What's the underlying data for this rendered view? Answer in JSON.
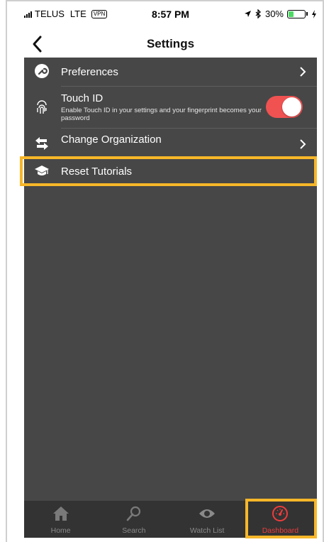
{
  "status_bar": {
    "carrier": "TELUS",
    "network": "LTE",
    "vpn": "VPN",
    "time": "8:57 PM",
    "battery": "30%",
    "battery_level": 0.3
  },
  "nav": {
    "title": "Settings",
    "back_icon": "chevron-left-icon"
  },
  "settings": {
    "preferences": {
      "label": "Preferences",
      "icon": "wrench-icon"
    },
    "touch_id": {
      "label": "Touch ID",
      "description": "Enable Touch ID in your settings and your fingerprint becomes your password",
      "icon": "fingerprint-icon",
      "enabled": true
    },
    "change_org": {
      "label": "Change Organization",
      "icon": "swap-arrows-icon"
    },
    "reset_tutorials": {
      "label": "Reset Tutorials",
      "icon": "graduation-cap-icon"
    }
  },
  "tabs": [
    {
      "label": "Home",
      "icon": "home-icon",
      "active": false
    },
    {
      "label": "Search",
      "icon": "search-icon",
      "active": false
    },
    {
      "label": "Watch List",
      "icon": "eye-icon",
      "active": false
    },
    {
      "label": "Dashboard",
      "icon": "speedometer-icon",
      "active": true
    }
  ],
  "colors": {
    "background": "#474747",
    "tab_bar": "#333333",
    "toggle_on": "#f05252",
    "active_tab": "#ee3c3c",
    "highlight": "#f7b728"
  }
}
